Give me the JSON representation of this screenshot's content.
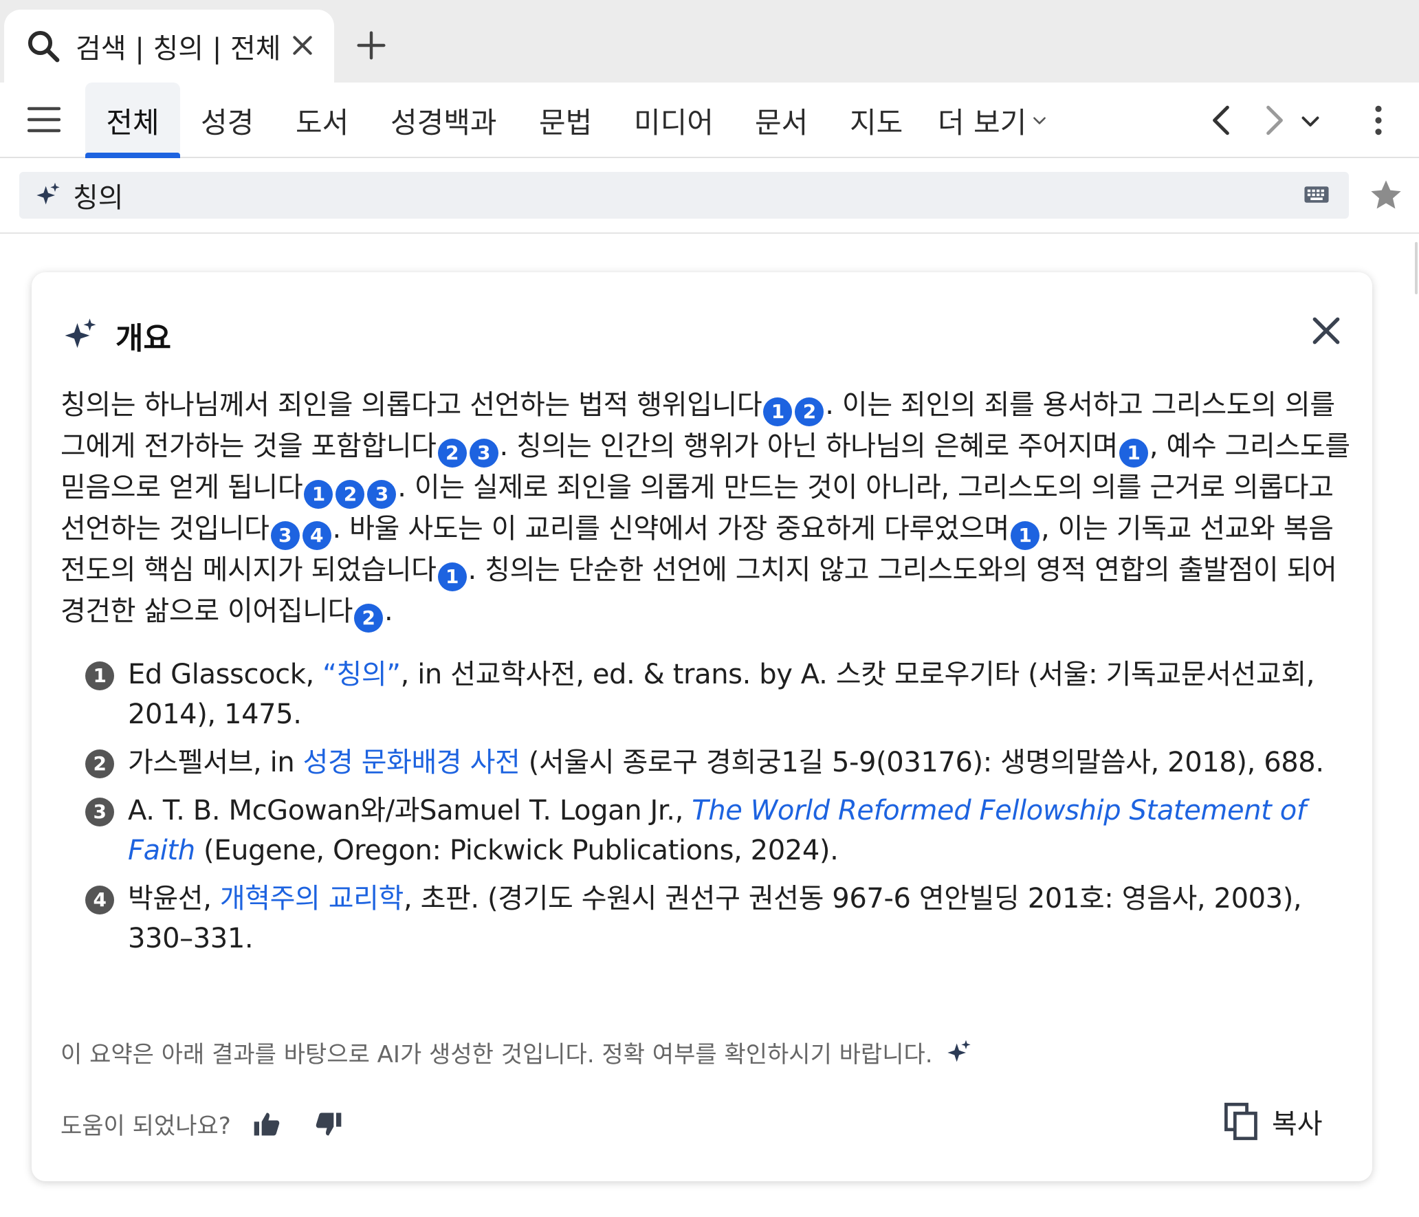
{
  "tab": {
    "title": "검색 | 칭의 | 전체"
  },
  "nav": {
    "tabs": [
      "전체",
      "성경",
      "도서",
      "성경백과",
      "문법",
      "미디어",
      "문서",
      "지도"
    ],
    "more_label": "더 보기"
  },
  "search": {
    "query": "칭의"
  },
  "summary": {
    "title": "개요",
    "segments": [
      {
        "text": "칭의는 하나님께서 죄인을 의롭다고 선언하는 법적 행위입니다",
        "cites": [
          "1",
          "2"
        ]
      },
      {
        "text": ". 이는 죄인의 죄를 용서하고 그리스도의 의를 그에게 전가하는 것을 포함합니다",
        "cites": [
          "2",
          "3"
        ]
      },
      {
        "text": ". 칭의는 인간의 행위가 아닌 하나님의 은혜로 주어지며",
        "cites": [
          "1"
        ]
      },
      {
        "text": ", 예수 그리스도를 믿음으로 얻게 됩니다",
        "cites": [
          "1",
          "2",
          "3"
        ]
      },
      {
        "text": ". 이는 실제로 죄인을 의롭게 만드는 것이 아니라, 그리스도의 의를 근거로 의롭다고 선언하는 것입니다",
        "cites": [
          "3",
          "4"
        ]
      },
      {
        "text": ". 바울 사도는 이 교리를 신약에서 가장 중요하게 다루었으며",
        "cites": [
          "1"
        ]
      },
      {
        "text": ", 이는 기독교 선교와 복음 전도의 핵심 메시지가 되었습니다",
        "cites": [
          "1"
        ]
      },
      {
        "text": ". 칭의는 단순한 선언에 그치지 않고 그리스도와의 영적 연합의 출발점이 되어 경건한 삶으로 이어집니다",
        "cites": [
          "2"
        ]
      },
      {
        "text": ".",
        "cites": []
      }
    ]
  },
  "references": [
    {
      "num": "1",
      "pre": "Ed Glasscock, ",
      "link": "“칭의”",
      "italic": false,
      "post": ", in 선교학사전, ed. & trans. by A. 스캇 모로우기타 (서울: 기독교문서선교회, 2014), 1475."
    },
    {
      "num": "2",
      "pre": "가스펠서브, in ",
      "link": "성경 문화배경 사전",
      "italic": false,
      "post": " (서울시 종로구 경희궁1길 5-9(03176): 생명의말씀사, 2018), 688."
    },
    {
      "num": "3",
      "pre": "A. T. B. McGowan와/과Samuel T. Logan Jr., ",
      "link": "The World Reformed Fellowship Statement of Faith",
      "italic": true,
      "post": " (Eugene, Oregon: Pickwick Publications, 2024)."
    },
    {
      "num": "4",
      "pre": "박윤선, ",
      "link": "개혁주의 교리학",
      "italic": false,
      "post": ", 초판. (경기도 수원시 권선구 권선동 967-6 연안빌딩 201호: 영음사, 2003), 330–331."
    }
  ],
  "disclaimer": "이 요약은 아래 결과를 바탕으로 AI가 생성한 것입니다. 정확 여부를 확인하시기 바랍니다.",
  "feedback_label": "도움이 되었나요?",
  "copy_label": "복사",
  "colors": {
    "accent": "#1d63e0",
    "citation_gray": "#555555"
  }
}
